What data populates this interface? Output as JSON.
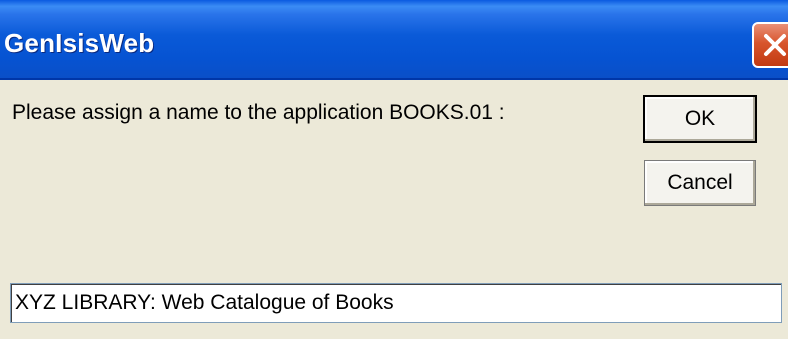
{
  "window": {
    "title": "GenIsisWeb"
  },
  "dialog": {
    "prompt": "Please assign a name to the application BOOKS.01 :",
    "ok_label": "OK",
    "cancel_label": "Cancel",
    "name_value": "XYZ LIBRARY: Web Catalogue of Books"
  },
  "icons": {
    "close": "close-icon"
  },
  "colors": {
    "titlebar": "#0a5ad8",
    "window_bg": "#ece9d8",
    "close_button": "#d8552c"
  }
}
